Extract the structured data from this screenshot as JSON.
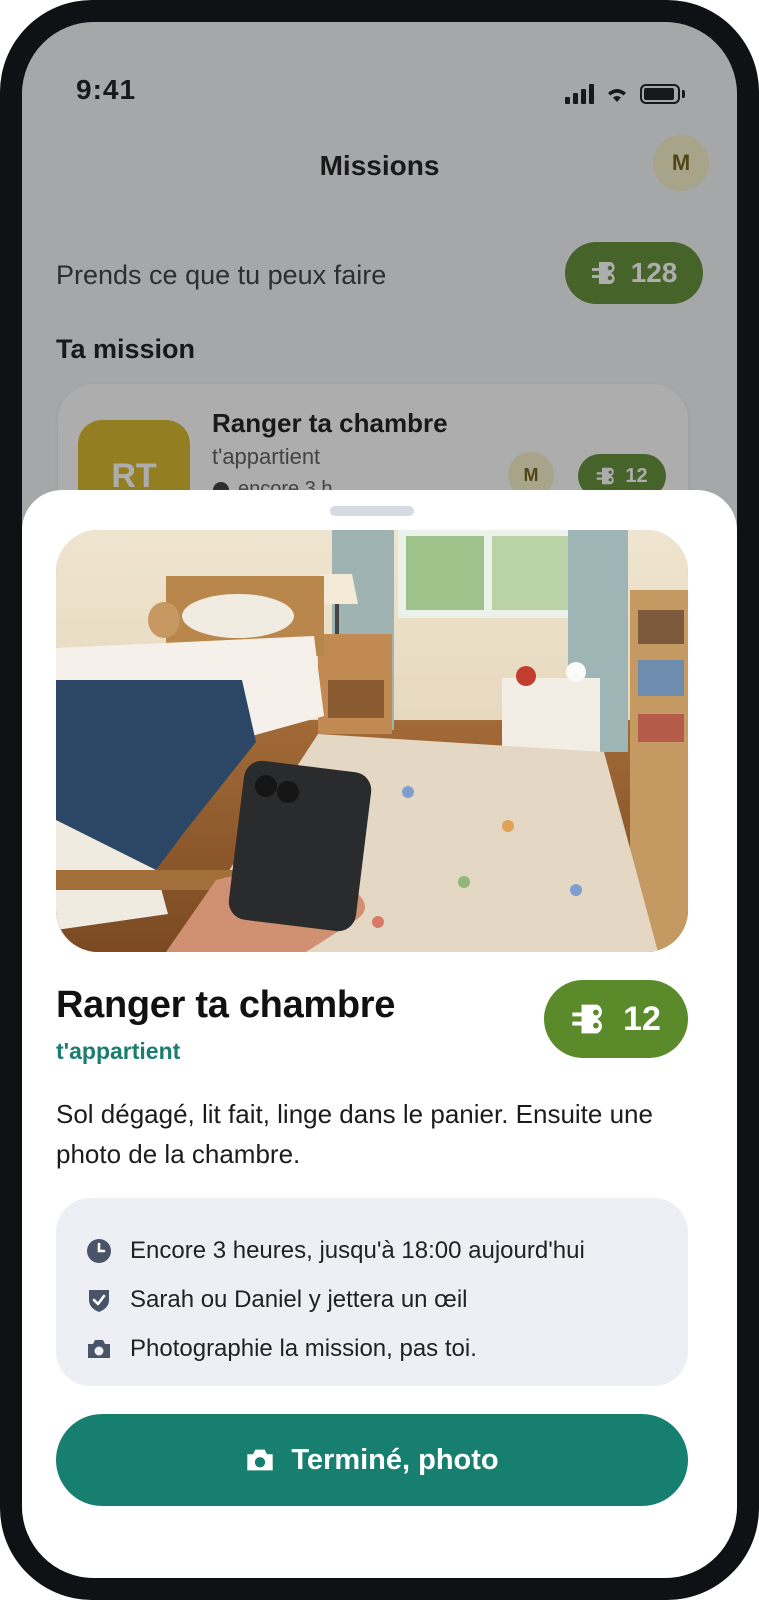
{
  "status_bar": {
    "time": "9:41"
  },
  "header": {
    "title": "Missions",
    "avatar_initial": "M"
  },
  "intro": {
    "subtitle": "Prends ce que tu peux faire",
    "coin_total": "128"
  },
  "section": {
    "title": "Ta mission"
  },
  "mission_card": {
    "icon_initials": "RT",
    "name": "Ranger ta chambre",
    "owner": "t'appartient",
    "time_left": "encore 3 h",
    "avatar_initial": "M",
    "coins": "12"
  },
  "sheet": {
    "title": "Ranger ta chambre",
    "owner": "t'appartient",
    "coins": "12",
    "description": "Sol dégagé, lit fait, linge dans le panier. Ensuite une photo de la chambre.",
    "info": [
      {
        "icon": "clock-icon",
        "text": "Encore 3 heures, jusqu'à 18:00 aujourd'hui"
      },
      {
        "icon": "shield-check-icon",
        "text": "Sarah ou Daniel y jettera un œil"
      },
      {
        "icon": "camera-icon",
        "text": "Photographie la mission, pas toi."
      }
    ],
    "cta_label": "Terminé, photo"
  },
  "colors": {
    "accent_teal": "#177f6f",
    "coin_green": "#5a8a2a",
    "owner_teal": "#1b7d6f",
    "avatar_bg": "#f6f0c6",
    "info_bg": "#edeff5"
  }
}
